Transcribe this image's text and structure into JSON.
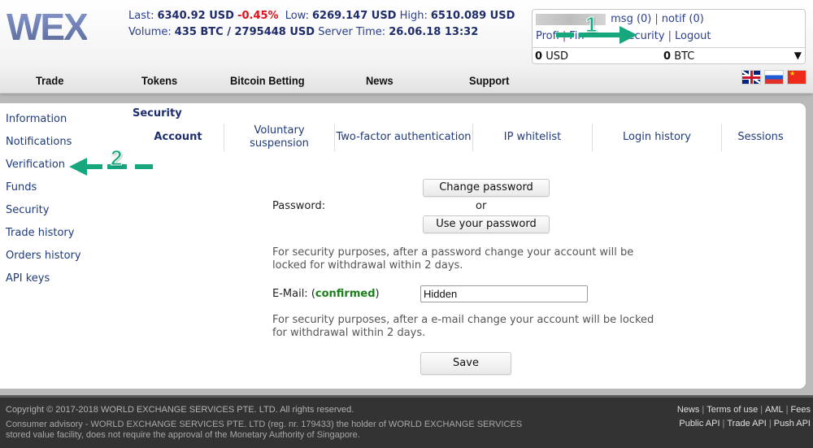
{
  "header": {
    "logo": "WEX",
    "ticker": {
      "last_label": "Last:",
      "last_value": "6340.92 USD",
      "change": "-0.45%",
      "low_label": "Low:",
      "low_value": "6269.147 USD",
      "high_label": "High:",
      "high_value": "6510.089 USD",
      "volume_label": "Volume:",
      "volume_value": "435 BTC / 2795448 USD",
      "server_time_label": "Server Time:",
      "server_time_value": "26.06.18 13:32"
    },
    "user": {
      "msg": "msg (0)",
      "notif": "notif (0)",
      "links": [
        "Profile",
        "Finances",
        "Security",
        "Logout"
      ],
      "visible_links": {
        "profile": "Profi",
        "finances": "Fin",
        "security": "Security",
        "logout": "Logout"
      },
      "usd_amount": "0",
      "usd_label": "USD",
      "btc_amount": "0",
      "btc_label": "BTC",
      "dropdown_icon": "▼"
    }
  },
  "nav": {
    "items": [
      "Trade",
      "Tokens",
      "Bitcoin Betting",
      "News",
      "Support"
    ],
    "languages": [
      "English",
      "Russian",
      "Chinese"
    ]
  },
  "sidebar": {
    "items": [
      "Information",
      "Notifications",
      "Verification",
      "Funds",
      "Security",
      "Trade history",
      "Orders history",
      "API keys"
    ]
  },
  "section": {
    "title": "Security",
    "tabs": [
      {
        "label": "Account",
        "active": true
      },
      {
        "label": "Voluntary suspension",
        "active": false
      },
      {
        "label": "Two-factor authentication",
        "active": false
      },
      {
        "label": "IP whitelist",
        "active": false
      },
      {
        "label": "Login history",
        "active": false
      },
      {
        "label": "Sessions",
        "active": false
      }
    ]
  },
  "form": {
    "password_label": "Password:",
    "change_password": "Change password",
    "or": "or",
    "use_password": "Use your password",
    "password_note": "For security purposes, after a password change your account will be locked for withdrawal within 2 days.",
    "email_label": "E-Mail: (",
    "email_status": "confirmed",
    "email_label_close": ")",
    "email_value": "Hidden",
    "email_note": "For security purposes, after a e-mail change your account will be locked for withdrawal within 2 days.",
    "save": "Save"
  },
  "annotations": {
    "one": "1",
    "two": "2"
  },
  "footer": {
    "copyright": "Copyright © 2017-2018 WORLD EXCHANGE SERVICES PTE. LTD. All rights reserved.",
    "advisory": "Consumer advisory - WORLD EXCHANGE SERVICES PTE. LTD (reg. nr. 179433) the holder of WORLD EXCHANGE SERVICES stored value facility, does not require the approval of the Monetary Authority of Singapore.",
    "links_row1": [
      "News",
      "Terms of use",
      "AML",
      "Fees"
    ],
    "links_row2": [
      "Public API",
      "Trade API",
      "Push API"
    ]
  },
  "colors": {
    "accent": "#1f3a7a",
    "negative": "#e0101a",
    "confirmed": "#1a7f1a",
    "annotation": "#16a77f"
  }
}
